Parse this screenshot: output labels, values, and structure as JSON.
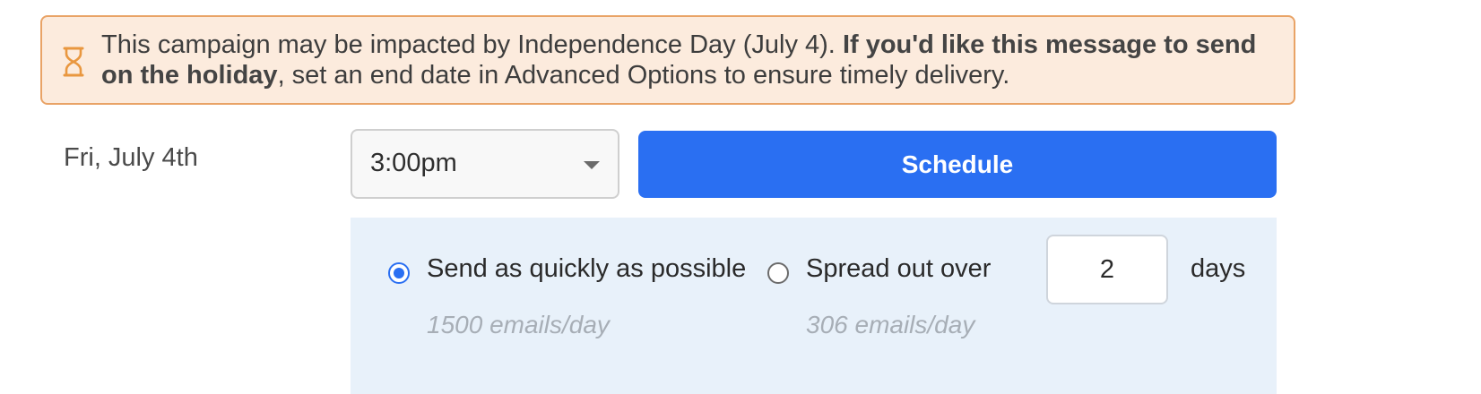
{
  "banner": {
    "icon": "hourglass-icon",
    "text_start": "This campaign may be impacted by Independence Day (July 4). ",
    "text_bold": "If you'd like this message to send on the holiday",
    "text_end": ", set an end date in Advanced Options to ensure timely delivery."
  },
  "schedule": {
    "date_label": "Fri, July 4th",
    "time_value": "3:00pm",
    "schedule_label": "Schedule"
  },
  "send_options": {
    "quick": {
      "label": "Send as quickly as possible",
      "rate": "1500 emails/day",
      "selected": true
    },
    "spread": {
      "label": "Spread out over",
      "days_value": "2",
      "days_unit": "days",
      "rate": "306 emails/day",
      "selected": false
    }
  },
  "colors": {
    "accent": "#2a6ff2",
    "banner_bg": "#fcebdd",
    "banner_border": "#e9a366",
    "panel_bg": "#e8f1fa"
  }
}
